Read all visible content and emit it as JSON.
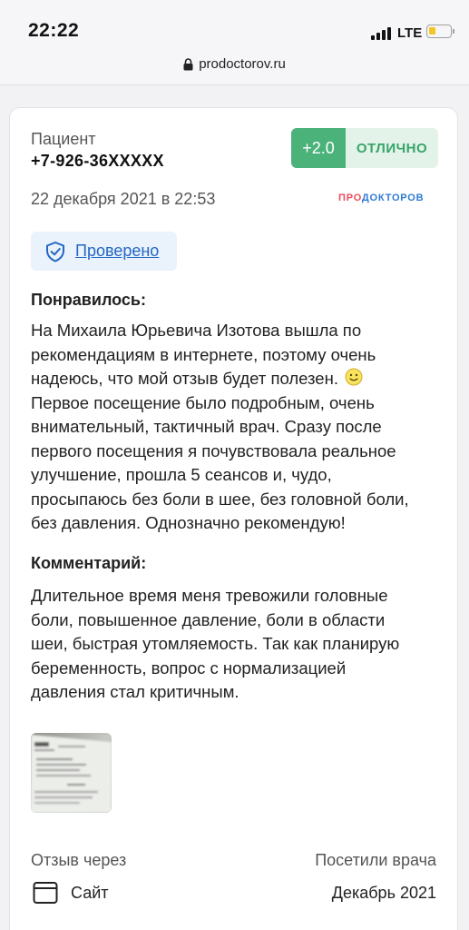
{
  "status": {
    "time": "22:22",
    "network": "LTE",
    "battery_level": 0.2
  },
  "browser": {
    "url": "prodoctorov.ru"
  },
  "review": {
    "author_label": "Пациент",
    "author_phone": "+7-926-36XXXXX",
    "score": "+2.0",
    "grade": "ОТЛИЧНО",
    "date": "22 декабря 2021 в 22:53",
    "brand_pro": "ПРО",
    "brand_rest": "ДОКТОРОВ",
    "verified": "Проверено",
    "liked_title": "Понравилось:",
    "liked_lines": [
      "На Михаила Юрьевича Изотова вышла по",
      "рекомендациям в интернете, поэтому очень",
      "надеюсь, что мой отзыв будет полезен.",
      "Первое посещение было подробным, очень",
      "внимательный, тактичный врач. Сразу после",
      "первого посещения я почувствовала реальное",
      "улучшение, прошла 5 сеансов и, чудо,",
      "просыпаюсь без боли в шее, без головной боли,",
      "без давления. Однозначно рекомендую!"
    ],
    "comment_title": "Комментарий:",
    "comment_lines": [
      "Длительное время меня тревожили головные",
      "боли, повышенное давление, боли в области",
      "шеи, быстрая утомляемость. Так как планирую",
      "беременность, вопрос с нормализацией",
      "давления стал критичным."
    ],
    "source_label": "Отзыв через",
    "source_value": "Сайт",
    "visit_label": "Посетили врача",
    "visit_value": "Декабрь 2021"
  },
  "colors": {
    "score_bg": "#4bb37a",
    "grade_bg": "#e3f3ea",
    "link": "#2466c4",
    "brand_blue": "#2e7bd6",
    "brand_red": "#ef4b5a"
  },
  "icons": [
    "lock-icon",
    "shield-check-icon",
    "smiley-icon",
    "browser-window-icon"
  ]
}
